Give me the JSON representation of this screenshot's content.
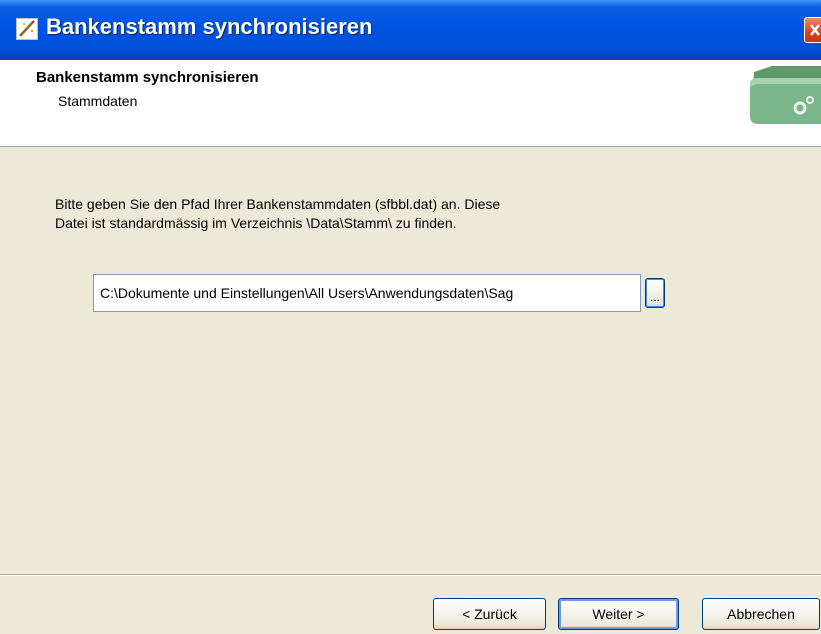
{
  "window": {
    "title": "Bankenstamm synchronisieren",
    "icon": "wizard-wand-icon",
    "close_icon": "close-icon"
  },
  "header": {
    "title": "Bankenstamm synchronisieren",
    "subtitle": "Stammdaten",
    "graphic": "folder-gear-icon"
  },
  "body": {
    "instruction_line1": "Bitte geben Sie den Pfad Ihrer Bankenstammdaten (sfbbl.dat) an. Diese",
    "instruction_line2": "Datei ist standardmässig im Verzeichnis \\Data\\Stamm\\ zu finden.",
    "path_value": "C:\\Dokumente und Einstellungen\\All Users\\Anwendungsdaten\\Sag",
    "browse_label": "..."
  },
  "buttons": {
    "back": "< Zurück",
    "next": "Weiter >",
    "cancel": "Abbrechen"
  },
  "colors": {
    "titlebar": "#0054e3",
    "dialog_bg": "#ece9d8",
    "close": "#d8431c",
    "folder": "#6aa67a"
  }
}
